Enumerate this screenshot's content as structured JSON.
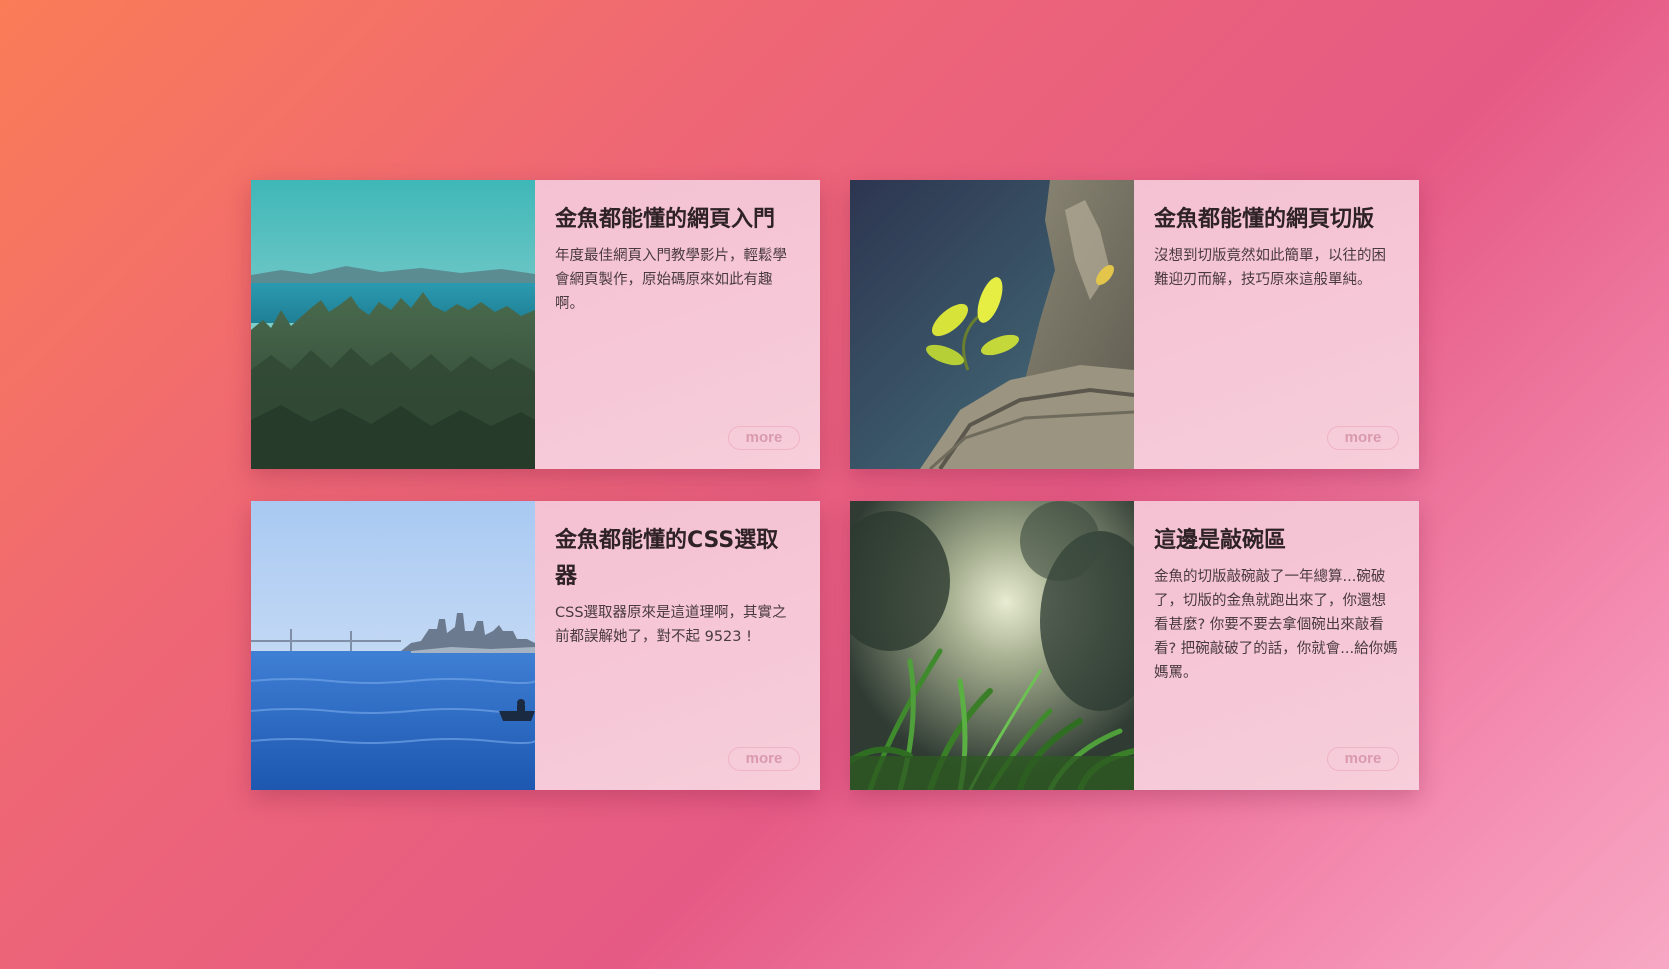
{
  "cards": [
    {
      "title": "金魚都能懂的網頁入門",
      "description": "年度最佳網頁入門教學影片，輕鬆學會網頁製作，原始碼原來如此有趣啊。",
      "more_label": "more",
      "image_icon": "forest-lake-photo"
    },
    {
      "title": "金魚都能懂的網頁切版",
      "description": "沒想到切版竟然如此簡單，以往的困難迎刃而解，技巧原來這般單純。",
      "more_label": "more",
      "image_icon": "sprout-on-log-photo"
    },
    {
      "title": "金魚都能懂的CSS選取器",
      "description": "CSS選取器原來是這道理啊，其實之前都誤解她了，對不起 9523 !",
      "more_label": "more",
      "image_icon": "city-bay-photo"
    },
    {
      "title": "這邊是敲碗區",
      "description": "金魚的切版敲碗敲了一年總算...碗破了，切版的金魚就跑出來了，你還想看甚麼? 你要不要去拿個碗出來敲看看? 把碗敲破了的話，你就會...給你媽媽罵。",
      "more_label": "more",
      "image_icon": "grass-closeup-photo"
    }
  ],
  "colors": {
    "card_bg": "#f6c6d6",
    "title_text": "#2e2226",
    "more_text": "#d99aae",
    "bg_start": "#fa7c57",
    "bg_end": "#f7a8c4"
  }
}
